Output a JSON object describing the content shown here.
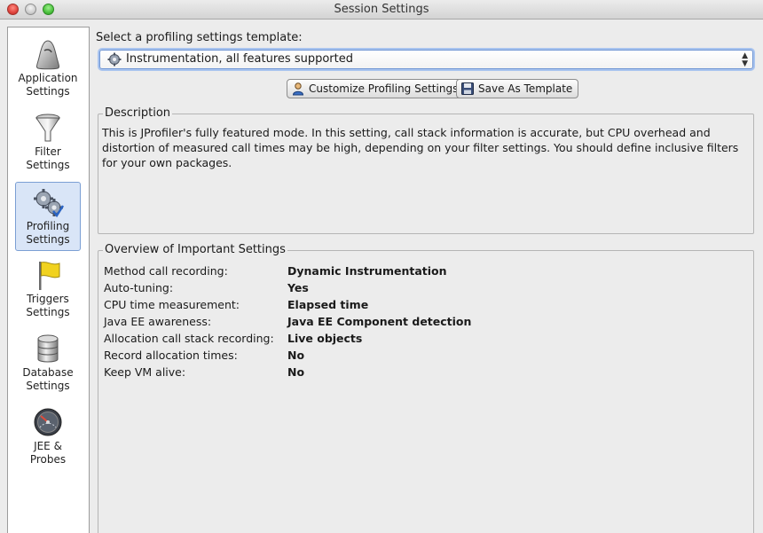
{
  "window": {
    "title": "Session Settings"
  },
  "sidebar": {
    "items": [
      {
        "label_line1": "Application",
        "label_line2": "Settings",
        "icon": "application-icon",
        "selected": false
      },
      {
        "label_line1": "Filter",
        "label_line2": "Settings",
        "icon": "filter-icon",
        "selected": false
      },
      {
        "label_line1": "Profiling",
        "label_line2": "Settings",
        "icon": "gears-icon",
        "selected": true
      },
      {
        "label_line1": "Triggers",
        "label_line2": "Settings",
        "icon": "flag-icon",
        "selected": false
      },
      {
        "label_line1": "Database",
        "label_line2": "Settings",
        "icon": "database-icon",
        "selected": false
      },
      {
        "label_line1": "JEE &",
        "label_line2": "Probes",
        "icon": "gauge-icon",
        "selected": false
      }
    ]
  },
  "template": {
    "label": "Select a profiling settings template:",
    "selected": "Instrumentation, all features supported"
  },
  "buttons": {
    "customize": "Customize Profiling Settings",
    "save_template": "Save As Template"
  },
  "description": {
    "title": "Description",
    "text": "This is JProfiler's fully featured mode. In this setting, call stack information is accurate, but CPU overhead and distortion of measured call times may be high, depending on your filter settings. You should define inclusive filters for your own packages."
  },
  "overview": {
    "title": "Overview of Important Settings",
    "rows": [
      {
        "key": "Method call recording:",
        "value": "Dynamic Instrumentation"
      },
      {
        "key": "Auto-tuning:",
        "value": "Yes"
      },
      {
        "key": "CPU time measurement:",
        "value": "Elapsed time"
      },
      {
        "key": "Java EE awareness:",
        "value": "Java EE Component detection"
      },
      {
        "key": "Allocation call stack recording:",
        "value": "Live objects"
      },
      {
        "key": "Record allocation times:",
        "value": "No"
      },
      {
        "key": "Keep VM alive:",
        "value": "No"
      }
    ]
  },
  "colors": {
    "selection_bg": "#d9e5f7",
    "selection_border": "#7b9fd4",
    "focus_ring": "#a9c4ef"
  }
}
